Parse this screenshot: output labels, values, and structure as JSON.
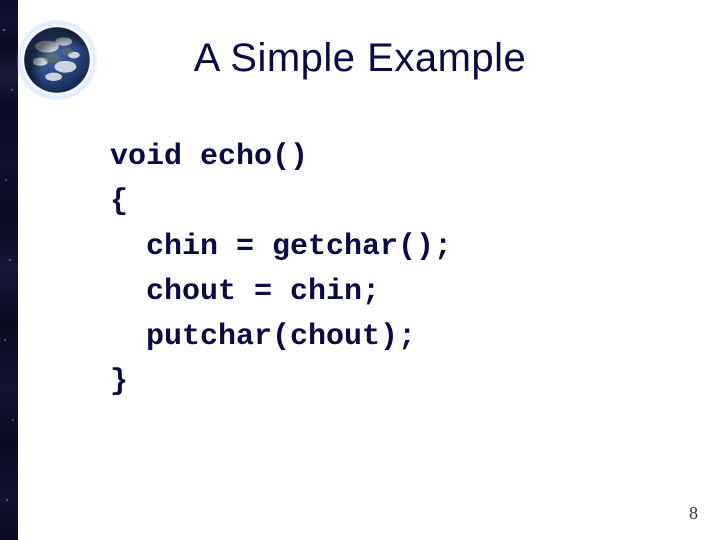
{
  "slide": {
    "title": "A Simple Example",
    "code": {
      "line1": "void echo()",
      "line2": "{",
      "line3": "  chin = getchar();",
      "line4": "  chout = chin;",
      "line5": "  putchar(chout);",
      "line6": "}"
    },
    "page_number": "8",
    "decor": {
      "earth_icon": "earth-icon",
      "starfield_strip": "starfield-strip"
    }
  }
}
